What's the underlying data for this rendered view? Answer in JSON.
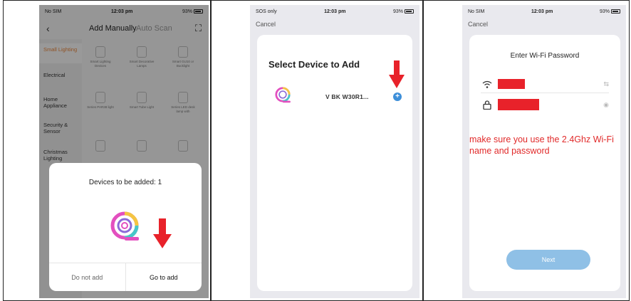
{
  "screen1": {
    "status": {
      "carrier": "No SIM",
      "time": "12:03 pm",
      "battery": "93%"
    },
    "nav": {
      "tab_manual": "Add Manually",
      "tab_scan": "Auto Scan"
    },
    "categories": [
      "Small Lighting",
      "Electrical",
      "Home Appliance",
      "Security & Sensor",
      "Christmas Lighting"
    ],
    "products": [
      "Smart Lighting Devices",
      "Smart Decorative Lamps",
      "Smart GU10 or Bucklight",
      "Series PAR38 light",
      "Smart Tube Light",
      "Series LED desk lamp with"
    ],
    "dialog": {
      "title": "Devices to be added: 1",
      "do_not_add": "Do not add",
      "go_to_add": "Go to add"
    }
  },
  "screen2": {
    "status": {
      "carrier": "SOS only",
      "time": "12:03 pm",
      "battery": "93%"
    },
    "cancel": "Cancel",
    "title": "Select Device to Add",
    "device_name": "V BK W30R1..."
  },
  "screen3": {
    "status": {
      "carrier": "No SIM",
      "time": "12:03 pm",
      "battery": "93%"
    },
    "cancel": "Cancel",
    "title": "Enter Wi-Fi Password",
    "note": "make sure you use the 2.4Ghz Wi-Fi name and password",
    "next": "Next"
  },
  "colors": {
    "annotation_red": "#e8222a",
    "accent_blue": "#3d8fd9",
    "next_button": "#8fc0e6",
    "active_category": "#e8853b"
  },
  "icons": [
    "back-chevron-icon",
    "scan-icon",
    "device-logo-icon",
    "add-plus-icon",
    "wifi-icon",
    "lock-icon",
    "swap-icon",
    "eye-icon",
    "red-down-arrow-icon"
  ]
}
